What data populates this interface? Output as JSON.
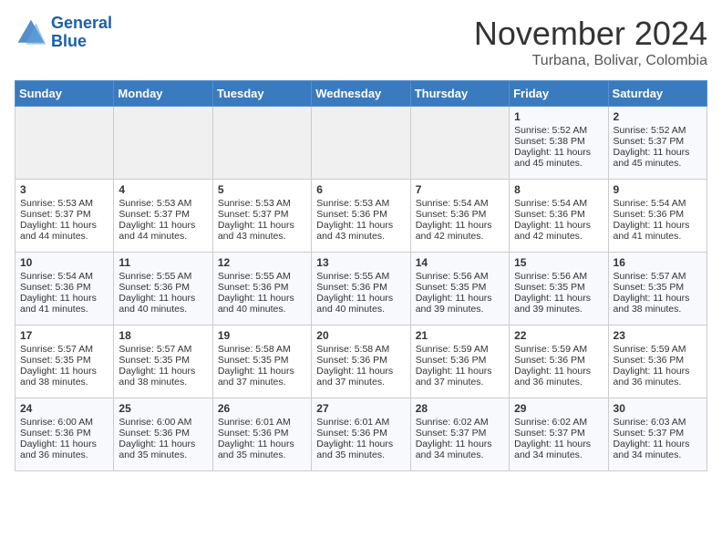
{
  "header": {
    "logo_line1": "General",
    "logo_line2": "Blue",
    "month_title": "November 2024",
    "location": "Turbana, Bolivar, Colombia"
  },
  "calendar": {
    "weekdays": [
      "Sunday",
      "Monday",
      "Tuesday",
      "Wednesday",
      "Thursday",
      "Friday",
      "Saturday"
    ],
    "weeks": [
      [
        {
          "day": "",
          "info": ""
        },
        {
          "day": "",
          "info": ""
        },
        {
          "day": "",
          "info": ""
        },
        {
          "day": "",
          "info": ""
        },
        {
          "day": "",
          "info": ""
        },
        {
          "day": "1",
          "info": "Sunrise: 5:52 AM\nSunset: 5:38 PM\nDaylight: 11 hours and 45 minutes."
        },
        {
          "day": "2",
          "info": "Sunrise: 5:52 AM\nSunset: 5:37 PM\nDaylight: 11 hours and 45 minutes."
        }
      ],
      [
        {
          "day": "3",
          "info": "Sunrise: 5:53 AM\nSunset: 5:37 PM\nDaylight: 11 hours and 44 minutes."
        },
        {
          "day": "4",
          "info": "Sunrise: 5:53 AM\nSunset: 5:37 PM\nDaylight: 11 hours and 44 minutes."
        },
        {
          "day": "5",
          "info": "Sunrise: 5:53 AM\nSunset: 5:37 PM\nDaylight: 11 hours and 43 minutes."
        },
        {
          "day": "6",
          "info": "Sunrise: 5:53 AM\nSunset: 5:36 PM\nDaylight: 11 hours and 43 minutes."
        },
        {
          "day": "7",
          "info": "Sunrise: 5:54 AM\nSunset: 5:36 PM\nDaylight: 11 hours and 42 minutes."
        },
        {
          "day": "8",
          "info": "Sunrise: 5:54 AM\nSunset: 5:36 PM\nDaylight: 11 hours and 42 minutes."
        },
        {
          "day": "9",
          "info": "Sunrise: 5:54 AM\nSunset: 5:36 PM\nDaylight: 11 hours and 41 minutes."
        }
      ],
      [
        {
          "day": "10",
          "info": "Sunrise: 5:54 AM\nSunset: 5:36 PM\nDaylight: 11 hours and 41 minutes."
        },
        {
          "day": "11",
          "info": "Sunrise: 5:55 AM\nSunset: 5:36 PM\nDaylight: 11 hours and 40 minutes."
        },
        {
          "day": "12",
          "info": "Sunrise: 5:55 AM\nSunset: 5:36 PM\nDaylight: 11 hours and 40 minutes."
        },
        {
          "day": "13",
          "info": "Sunrise: 5:55 AM\nSunset: 5:36 PM\nDaylight: 11 hours and 40 minutes."
        },
        {
          "day": "14",
          "info": "Sunrise: 5:56 AM\nSunset: 5:35 PM\nDaylight: 11 hours and 39 minutes."
        },
        {
          "day": "15",
          "info": "Sunrise: 5:56 AM\nSunset: 5:35 PM\nDaylight: 11 hours and 39 minutes."
        },
        {
          "day": "16",
          "info": "Sunrise: 5:57 AM\nSunset: 5:35 PM\nDaylight: 11 hours and 38 minutes."
        }
      ],
      [
        {
          "day": "17",
          "info": "Sunrise: 5:57 AM\nSunset: 5:35 PM\nDaylight: 11 hours and 38 minutes."
        },
        {
          "day": "18",
          "info": "Sunrise: 5:57 AM\nSunset: 5:35 PM\nDaylight: 11 hours and 38 minutes."
        },
        {
          "day": "19",
          "info": "Sunrise: 5:58 AM\nSunset: 5:35 PM\nDaylight: 11 hours and 37 minutes."
        },
        {
          "day": "20",
          "info": "Sunrise: 5:58 AM\nSunset: 5:36 PM\nDaylight: 11 hours and 37 minutes."
        },
        {
          "day": "21",
          "info": "Sunrise: 5:59 AM\nSunset: 5:36 PM\nDaylight: 11 hours and 37 minutes."
        },
        {
          "day": "22",
          "info": "Sunrise: 5:59 AM\nSunset: 5:36 PM\nDaylight: 11 hours and 36 minutes."
        },
        {
          "day": "23",
          "info": "Sunrise: 5:59 AM\nSunset: 5:36 PM\nDaylight: 11 hours and 36 minutes."
        }
      ],
      [
        {
          "day": "24",
          "info": "Sunrise: 6:00 AM\nSunset: 5:36 PM\nDaylight: 11 hours and 36 minutes."
        },
        {
          "day": "25",
          "info": "Sunrise: 6:00 AM\nSunset: 5:36 PM\nDaylight: 11 hours and 35 minutes."
        },
        {
          "day": "26",
          "info": "Sunrise: 6:01 AM\nSunset: 5:36 PM\nDaylight: 11 hours and 35 minutes."
        },
        {
          "day": "27",
          "info": "Sunrise: 6:01 AM\nSunset: 5:36 PM\nDaylight: 11 hours and 35 minutes."
        },
        {
          "day": "28",
          "info": "Sunrise: 6:02 AM\nSunset: 5:37 PM\nDaylight: 11 hours and 34 minutes."
        },
        {
          "day": "29",
          "info": "Sunrise: 6:02 AM\nSunset: 5:37 PM\nDaylight: 11 hours and 34 minutes."
        },
        {
          "day": "30",
          "info": "Sunrise: 6:03 AM\nSunset: 5:37 PM\nDaylight: 11 hours and 34 minutes."
        }
      ]
    ]
  }
}
